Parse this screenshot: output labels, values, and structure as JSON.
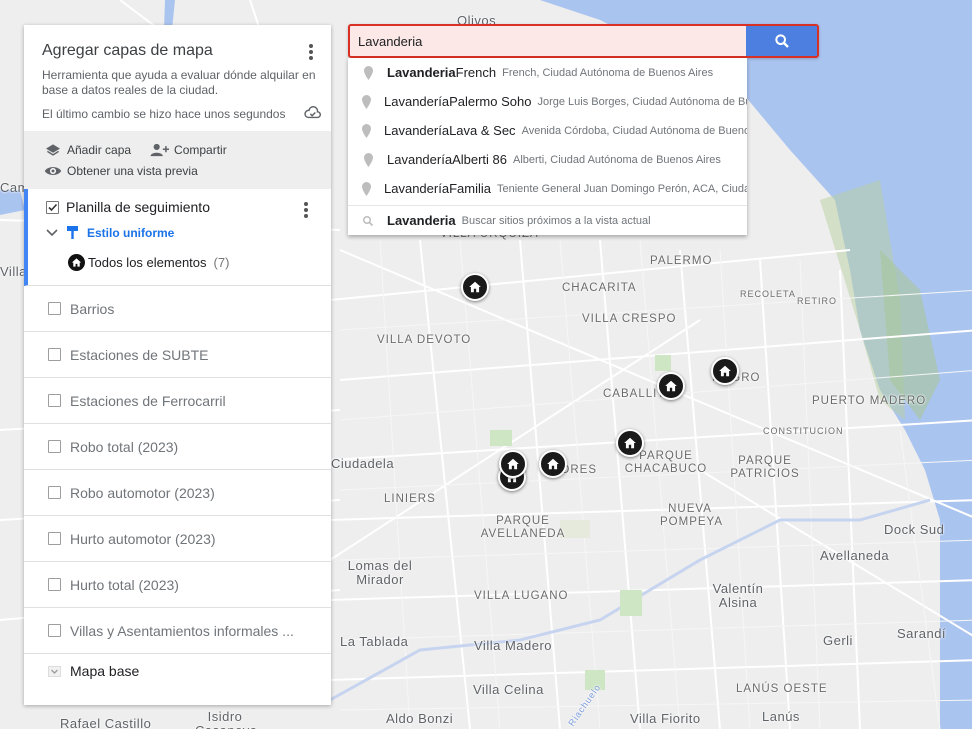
{
  "map": {
    "labels": [
      "Olivos",
      "VILLA URQUIZA",
      "PALERMO",
      "RECOLETA",
      "RETIRO",
      "CHACARITA",
      "VILLA CRESPO",
      "VILLA DEVOTO",
      "CABALLITO",
      "MAGRO",
      "PUERTO MADERO",
      "CONSTITUCION",
      "PARQUE CHACABUCO",
      "PARQUE PATRICIOS",
      "FLORES",
      "LINIERS",
      "PARQUE AVELLANEDA",
      "NUEVA POMPEYA",
      "Dock Sud",
      "Avellaneda",
      "Lomas del Mirador",
      "VILLA LUGANO",
      "Valentín Alsina",
      "La Tablada",
      "Villa Madero",
      "Gerli",
      "Sarandí",
      "Villa Celina",
      "LANÚS OESTE",
      "Lanús",
      "Aldo Bonzi",
      "Villa Fiorito",
      "Rafael Castillo",
      "Isidro Casanova",
      "Ciudadela",
      "Campo",
      "Villa Martelli",
      "Riachuelo"
    ],
    "pin_icon": "home-icon",
    "pin_color": "#111111"
  },
  "panel": {
    "title": "Agregar capas de mapa",
    "description": "Herramienta que ayuda a evaluar dónde alquilar en base a datos reales de la ciudad.",
    "status": "El último cambio se hizo hace unos segundos",
    "actions": {
      "add_layer": "Añadir capa",
      "share": "Compartir",
      "preview": "Obtener una vista previa"
    },
    "active_layer": {
      "name": "Planilla de seguimiento",
      "checked": true,
      "style": "Estilo uniforme",
      "items_label": "Todos los elementos",
      "items_count": "(7)"
    },
    "layers": [
      {
        "name": "Barrios"
      },
      {
        "name": "Estaciones de SUBTE"
      },
      {
        "name": "Estaciones de Ferrocarril"
      },
      {
        "name": "Robo total (2023)"
      },
      {
        "name": "Robo automotor (2023)"
      },
      {
        "name": "Hurto automotor (2023)"
      },
      {
        "name": "Hurto total (2023)"
      },
      {
        "name": "Villas y Asentamientos informales ..."
      }
    ],
    "basemap": "Mapa base"
  },
  "search": {
    "value": "Lavanderia",
    "accent": "#d93025",
    "button_color": "#4d7fe0",
    "suggestions": [
      {
        "bold": "Lavanderia",
        "rest": " French",
        "sub": "French, Ciudad Autónoma de Buenos Aires"
      },
      {
        "bold": "Lavandería",
        "rest": " Palermo Soho",
        "sub": "Jorge Luis Borges, Ciudad Autónoma de Bu"
      },
      {
        "bold": "Lavandería",
        "rest": " Lava & Sec",
        "sub": "Avenida Córdoba, Ciudad Autónoma de Buenos"
      },
      {
        "bold": "Lavandería",
        "rest": " Alberti 86",
        "sub": "Alberti, Ciudad Autónoma de Buenos Aires"
      },
      {
        "bold": "Lavandería",
        "rest": " Familia",
        "sub": "Teniente General Juan Domingo Perón, ACA, Ciuda"
      }
    ],
    "nearby": {
      "bold": "Lavanderia",
      "sub": "Buscar sitios próximos a la vista actual"
    }
  }
}
